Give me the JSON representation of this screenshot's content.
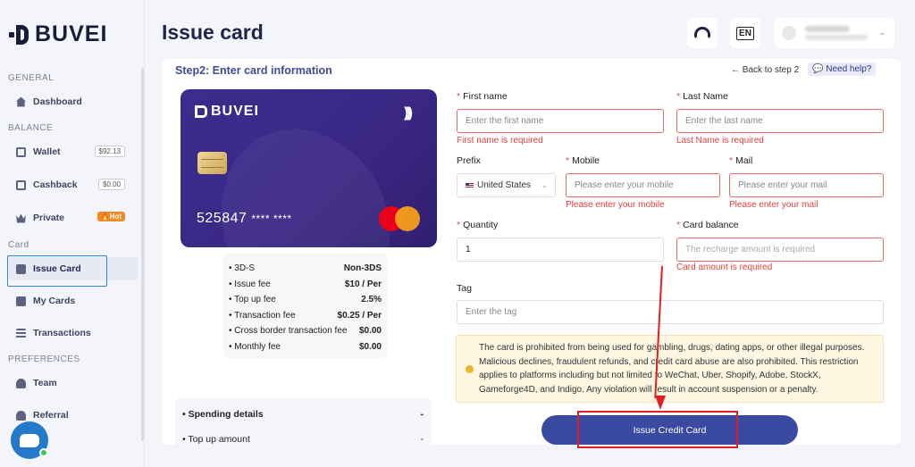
{
  "brand": {
    "name": "BUVEI"
  },
  "sidebar": {
    "sections": {
      "general": "GENERAL",
      "balance": "BALANCE",
      "card": "Card",
      "preferences": "PREFERENCES"
    },
    "items": [
      {
        "label": "Dashboard",
        "icon": "house-icon"
      },
      {
        "label": "Wallet",
        "badge": "$92.13",
        "icon": "wallet-icon"
      },
      {
        "label": "Cashback",
        "badge": "$0.00",
        "icon": "cashback-icon"
      },
      {
        "label": "Private",
        "badge": "🔥Hot",
        "icon": "crown-icon"
      },
      {
        "label": "Issue Card",
        "icon": "card-icon",
        "active": true
      },
      {
        "label": "My Cards",
        "icon": "cards-icon"
      },
      {
        "label": "Transactions",
        "icon": "list-icon"
      },
      {
        "label": "Team",
        "icon": "team-icon"
      },
      {
        "label": "Referral",
        "icon": "referral-icon"
      }
    ]
  },
  "header": {
    "title": "Issue card",
    "lang": "EN"
  },
  "main": {
    "step_title": "Step2: Enter card information",
    "back_link": "← Back to step 2",
    "help": "Need help?",
    "card_preview": {
      "brand": "BUVEI",
      "number_prefix": "525847",
      "number_masked": "**** ****"
    },
    "fees": [
      {
        "label": "• 3D-S",
        "value": "Non-3DS"
      },
      {
        "label": "• Issue fee",
        "value": "$10 / Per"
      },
      {
        "label": "• Top up fee",
        "value": "2.5%"
      },
      {
        "label": "• Transaction fee",
        "value": "$0.25 / Per"
      },
      {
        "label": "• Cross border transaction fee",
        "value": "$0.00"
      },
      {
        "label": "• Monthly fee",
        "value": "$0.00"
      }
    ],
    "spending": {
      "title": "• Spending details",
      "title_value": "-",
      "row1": "• Top up amount",
      "row1_value": "-"
    },
    "form": {
      "first_name_label": "First name",
      "first_name_placeholder": "Enter the first name",
      "first_name_error": "First name is required",
      "last_name_label": "Last Name",
      "last_name_placeholder": "Enter the last name",
      "last_name_error": "Last Name is required",
      "prefix_label": "Prefix",
      "prefix_value": "United States",
      "mobile_label": "Mobile",
      "mobile_placeholder": "Please enter your mobile",
      "mobile_error": "Please enter your mobile",
      "mail_label": "Mail",
      "mail_placeholder": "Please enter your mail",
      "mail_error": "Please enter your mail",
      "quantity_label": "Quantity",
      "quantity_value": "1",
      "balance_label": "Card balance",
      "balance_placeholder": "The recharge amount is required",
      "balance_error": "Card amount is required",
      "tag_label": "Tag",
      "tag_placeholder": "Enter the tag"
    },
    "notice": "The card is prohibited from being used for gambling, drugs, dating apps, or other illegal purposes. Malicious declines, fraudulent refunds, and credit card abuse are also prohibited. This restriction applies to platforms including but not limited to WeChat, Uber, Shopify, Adobe, StockX, Gameforge4D, and Indigo. Any violation will result in account suspension or a penalty.",
    "submit_label": "Issue Credit Card"
  },
  "colors": {
    "accent": "#3a4aa0",
    "error": "#e33d3d",
    "annotation": "#e02020"
  }
}
